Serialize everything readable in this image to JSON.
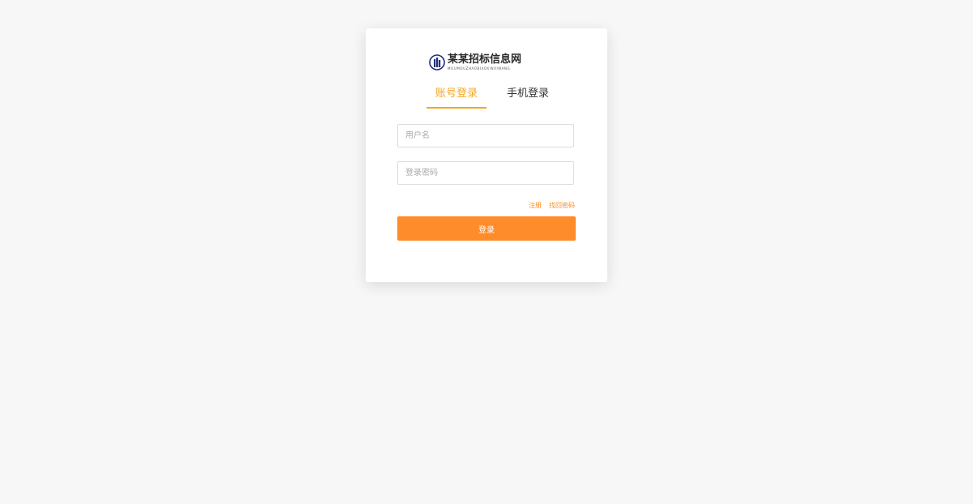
{
  "brand": {
    "title": "某某招标信息网",
    "subtitle": "MOUMOUZHAOBIAOXINXIWANG",
    "colors": {
      "logo": "#1f2f7a"
    }
  },
  "tabs": [
    {
      "label": "账号登录",
      "active": true
    },
    {
      "label": "手机登录",
      "active": false
    }
  ],
  "form": {
    "username_placeholder": "用户名",
    "password_placeholder": "登录密码",
    "register_label": "注册",
    "forgot_label": "找回密码",
    "submit_label": "登录"
  },
  "colors": {
    "accent": "#ff8c2b",
    "tab_active": "#f5a623",
    "background": "#f7f7f7"
  }
}
